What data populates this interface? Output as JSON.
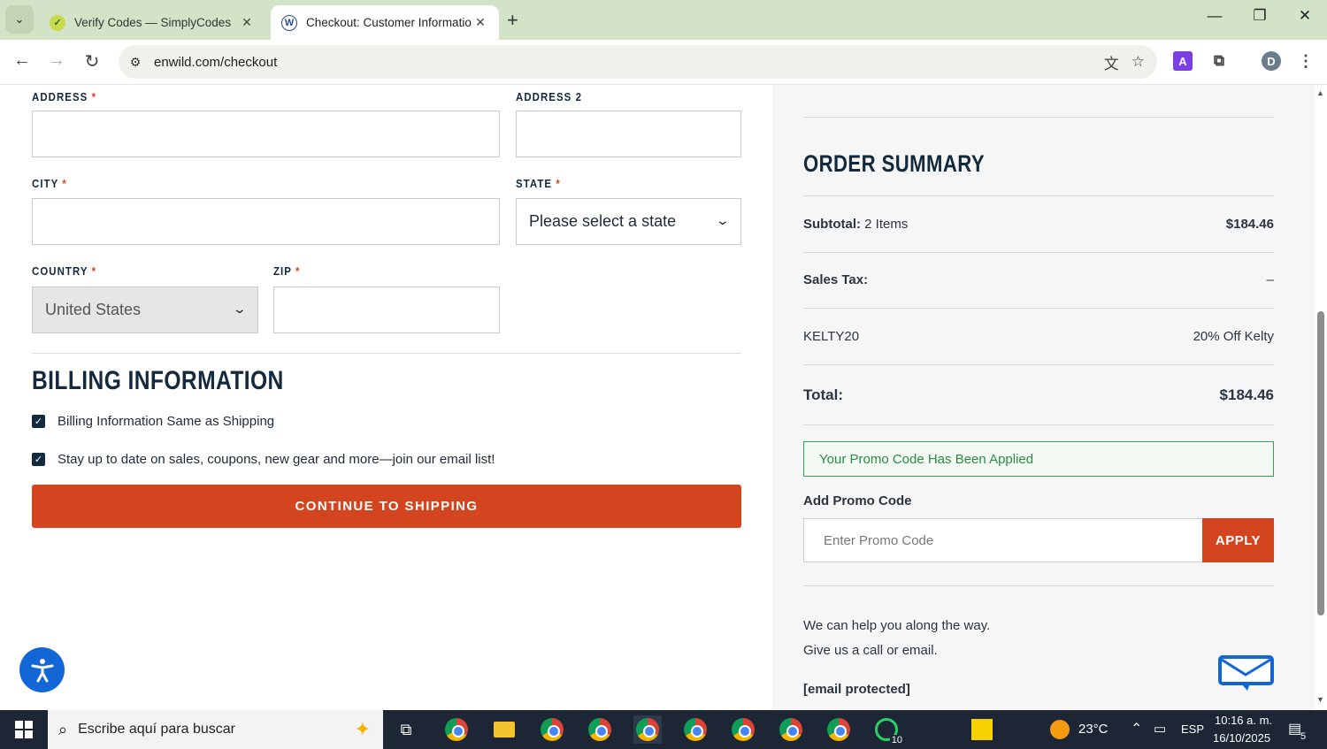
{
  "browser": {
    "tabs": [
      {
        "title": "Verify Codes — SimplyCodes",
        "active": false
      },
      {
        "title": "Checkout: Customer Informatio",
        "active": true
      }
    ],
    "url": "enwild.com/checkout",
    "profile_initial": "D"
  },
  "shipping": {
    "address_label": "ADDRESS",
    "address2_label": "ADDRESS 2",
    "city_label": "CITY",
    "state_label": "STATE",
    "state_value": "Please select a state",
    "country_label": "COUNTRY",
    "country_value": "United States",
    "zip_label": "ZIP",
    "required_mark": "*"
  },
  "billing": {
    "title": "BILLING INFORMATION",
    "same_as_shipping": "Billing Information Same as Shipping",
    "newsletter": "Stay up to date on sales, coupons, new gear and more—join our email list!",
    "continue_label": "CONTINUE TO SHIPPING"
  },
  "summary": {
    "title": "ORDER SUMMARY",
    "subtotal_label": "Subtotal:",
    "subtotal_items": "2 Items",
    "subtotal_value": "$184.46",
    "tax_label": "Sales Tax:",
    "tax_value": "–",
    "promo_code": "KELTY20",
    "promo_desc": "20% Off Kelty",
    "total_label": "Total:",
    "total_value": "$184.46",
    "promo_applied": "Your Promo Code Has Been Applied",
    "add_promo_label": "Add Promo Code",
    "promo_placeholder": "Enter Promo Code",
    "apply_label": "APPLY",
    "help_line1": "We can help you along the way.",
    "help_line2": "Give us a call or email.",
    "email": "[email protected]"
  },
  "taskbar": {
    "search_placeholder": "Escribe aquí para buscar",
    "weather": "23°C",
    "language": "ESP",
    "time": "10:16 a. m.",
    "date": "16/10/2025",
    "whatsapp_badge": "10",
    "notifications": "5"
  },
  "colors": {
    "accent": "#d3451e",
    "navy": "#13293d",
    "success": "#39a154"
  }
}
